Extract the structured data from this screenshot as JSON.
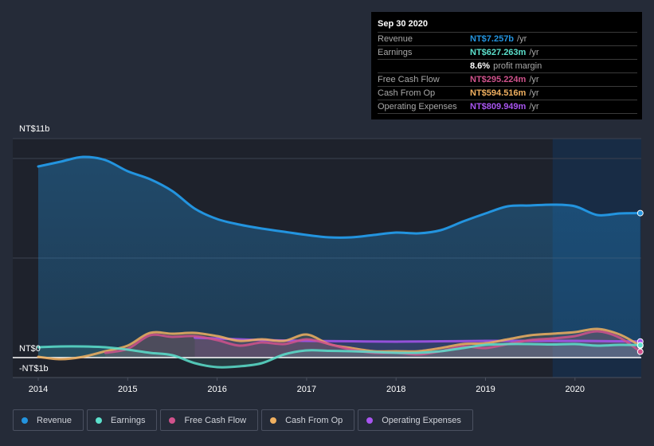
{
  "tooltip": {
    "date": "Sep 30 2020",
    "rows": [
      {
        "label": "Revenue",
        "value": "NT$7.257b",
        "unit": "/yr",
        "color": "#2394df"
      },
      {
        "label": "Earnings",
        "value": "NT$627.263m",
        "unit": "/yr",
        "color": "#5ce0cc"
      },
      {
        "label": "",
        "value": "8.6%",
        "unit": "profit margin",
        "color": "#ffffff"
      },
      {
        "label": "Free Cash Flow",
        "value": "NT$295.224m",
        "unit": "/yr",
        "color": "#d0528c"
      },
      {
        "label": "Cash From Op",
        "value": "NT$594.516m",
        "unit": "/yr",
        "color": "#f0b060"
      },
      {
        "label": "Operating Expenses",
        "value": "NT$809.949m",
        "unit": "/yr",
        "color": "#a855f0"
      }
    ]
  },
  "legend": [
    {
      "label": "Revenue",
      "color": "#2394df"
    },
    {
      "label": "Earnings",
      "color": "#5ce0cc"
    },
    {
      "label": "Free Cash Flow",
      "color": "#d0528c"
    },
    {
      "label": "Cash From Op",
      "color": "#f0b060"
    },
    {
      "label": "Operating Expenses",
      "color": "#a855f0"
    }
  ],
  "chart_data": {
    "type": "area",
    "title": "",
    "xlabel": "",
    "ylabel": "",
    "currency": "NT$",
    "xlim": [
      2013.7,
      2020.75
    ],
    "ylim": [
      -1.0,
      11.0
    ],
    "y_unit": "billions",
    "y_tick_labels": [
      {
        "value": 11,
        "label": "NT$11b"
      },
      {
        "value": 0,
        "label": "NT$0"
      },
      {
        "value": -1,
        "label": "-NT$1b"
      }
    ],
    "gridlines": [
      11,
      10,
      5,
      0
    ],
    "x_ticks": [
      {
        "value": 2014,
        "label": "2014"
      },
      {
        "value": 2015,
        "label": "2015"
      },
      {
        "value": 2016,
        "label": "2016"
      },
      {
        "value": 2017,
        "label": "2017"
      },
      {
        "value": 2018,
        "label": "2018"
      },
      {
        "value": 2019,
        "label": "2019"
      },
      {
        "value": 2020,
        "label": "2020"
      }
    ],
    "highlight_from": 2019.75,
    "series": [
      {
        "name": "Revenue",
        "color": "#2394df",
        "x": [
          2014.0,
          2014.25,
          2014.5,
          2014.75,
          2015.0,
          2015.25,
          2015.5,
          2015.75,
          2016.0,
          2016.25,
          2016.5,
          2016.75,
          2017.0,
          2017.25,
          2017.5,
          2017.75,
          2018.0,
          2018.25,
          2018.5,
          2018.75,
          2019.0,
          2019.25,
          2019.5,
          2019.75,
          2020.0,
          2020.25,
          2020.5,
          2020.73
        ],
        "values": [
          9.6,
          9.84,
          10.08,
          9.92,
          9.36,
          8.96,
          8.36,
          7.48,
          6.96,
          6.68,
          6.48,
          6.32,
          6.16,
          6.04,
          6.04,
          6.16,
          6.28,
          6.24,
          6.4,
          6.84,
          7.24,
          7.6,
          7.64,
          7.68,
          7.6,
          7.16,
          7.24,
          7.257
        ]
      },
      {
        "name": "Earnings",
        "color": "#5ce0cc",
        "x": [
          2014.0,
          2014.25,
          2014.5,
          2014.75,
          2015.0,
          2015.25,
          2015.5,
          2015.75,
          2016.0,
          2016.25,
          2016.5,
          2016.75,
          2017.0,
          2017.25,
          2017.5,
          2017.75,
          2018.0,
          2018.25,
          2018.5,
          2018.75,
          2019.0,
          2019.25,
          2019.5,
          2019.75,
          2020.0,
          2020.25,
          2020.5,
          2020.73
        ],
        "values": [
          0.52,
          0.56,
          0.56,
          0.52,
          0.4,
          0.24,
          0.12,
          -0.28,
          -0.48,
          -0.44,
          -0.28,
          0.16,
          0.36,
          0.34,
          0.32,
          0.28,
          0.24,
          0.24,
          0.32,
          0.48,
          0.64,
          0.68,
          0.68,
          0.66,
          0.68,
          0.6,
          0.64,
          0.627
        ]
      },
      {
        "name": "Free Cash Flow",
        "color": "#d0528c",
        "x": [
          2014.75,
          2015.0,
          2015.25,
          2015.5,
          2015.75,
          2016.0,
          2016.25,
          2016.5,
          2016.75,
          2017.0,
          2017.25,
          2017.5,
          2017.75,
          2018.0,
          2018.25,
          2018.5,
          2018.75,
          2019.0,
          2019.25,
          2019.5,
          2019.75,
          2020.0,
          2020.25,
          2020.5,
          2020.73
        ],
        "values": [
          0.24,
          0.44,
          1.12,
          1.04,
          1.08,
          0.88,
          0.6,
          0.76,
          0.68,
          0.92,
          0.68,
          0.4,
          0.24,
          0.24,
          0.16,
          0.32,
          0.56,
          0.48,
          0.68,
          0.88,
          0.96,
          1.08,
          1.32,
          1.0,
          0.295
        ]
      },
      {
        "name": "Cash From Op",
        "color": "#f0b060",
        "x": [
          2014.0,
          2014.25,
          2014.5,
          2014.75,
          2015.0,
          2015.25,
          2015.5,
          2015.75,
          2016.0,
          2016.25,
          2016.5,
          2016.75,
          2017.0,
          2017.25,
          2017.5,
          2017.75,
          2018.0,
          2018.25,
          2018.5,
          2018.75,
          2019.0,
          2019.25,
          2019.5,
          2019.75,
          2020.0,
          2020.25,
          2020.5,
          2020.73
        ],
        "values": [
          0.04,
          -0.08,
          0.04,
          0.32,
          0.6,
          1.24,
          1.2,
          1.24,
          1.08,
          0.84,
          0.92,
          0.84,
          1.16,
          0.68,
          0.48,
          0.32,
          0.32,
          0.32,
          0.48,
          0.68,
          0.72,
          0.92,
          1.12,
          1.2,
          1.28,
          1.44,
          1.16,
          0.595
        ]
      },
      {
        "name": "Operating Expenses",
        "color": "#a855f0",
        "x": [
          2015.75,
          2016.0,
          2016.5,
          2017.0,
          2017.5,
          2018.0,
          2018.5,
          2019.0,
          2019.5,
          2020.0,
          2020.5,
          2020.73
        ],
        "values": [
          1.0,
          0.96,
          0.88,
          0.84,
          0.82,
          0.8,
          0.82,
          0.84,
          0.84,
          0.84,
          0.82,
          0.81
        ]
      }
    ]
  }
}
